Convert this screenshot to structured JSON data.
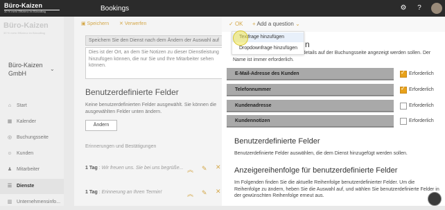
{
  "topbar": {
    "logo_title": "Büro-Kaizen",
    "logo_tagline": "30 % mehr Effizienz im Büroalltag",
    "app_title": "Bookings",
    "settings_icon": "gear-icon",
    "help_icon": "question-icon"
  },
  "sidebar": {
    "brand": "Büro-Kaizen",
    "brand_tag": "30 % mehr Effizienz im Büroalltag",
    "company": "Büro-Kaizen GmbH",
    "items": [
      {
        "label": "Start",
        "icon": "home-icon"
      },
      {
        "label": "Kalender",
        "icon": "calendar-icon"
      },
      {
        "label": "Buchungsseite",
        "icon": "globe-icon"
      },
      {
        "label": "Kunden",
        "icon": "people-icon"
      },
      {
        "label": "Mitarbeiter",
        "icon": "person-icon"
      },
      {
        "label": "Dienste",
        "icon": "list-icon",
        "active": true
      },
      {
        "label": "Unternehmensinfo...",
        "icon": "building-icon"
      }
    ]
  },
  "middle": {
    "save_label": "Speichern",
    "discard_label": "Verwerfen",
    "hint": "Speichern Sie den Dienst nach dem Ändern der Auswahl auf",
    "notes": "Dies ist der Ort, an dem Sie Notizen zu dieser Dienstleistung hinzufügen können, die nur Sie und Ihre Mitarbeiter sehen können.",
    "custom_fields_heading": "Benutzerdefinierte Felder",
    "custom_fields_text": "Keine benutzerdefinierten Felder ausgewählt. Sie können die ausgewählten Felder unten ändern.",
    "change_button": "Ändern",
    "reminders_heading": "Erinnerungen und Bestätigungen",
    "reminders": [
      {
        "when": "1 Tag",
        "text": "Wir freuen uns. Sie bei uns begrüße..."
      },
      {
        "when": "1 Tag",
        "text": "Erinnerung an Ihren Termin!"
      }
    ]
  },
  "panel": {
    "ok_label": "OK",
    "add_question_label": "Add a question",
    "dropdown_items": [
      "Textfrage hinzufügen",
      "Dropdownfrage hinzufügen"
    ],
    "heading_partial": "n",
    "intro": "Wählen Sie aus, welche Kundendetails auf der Buchungsseite angezeigt werden sollen. Der Name ist immer erforderlich.",
    "fields": [
      {
        "label": "E-Mail-Adresse des Kunden",
        "required": true
      },
      {
        "label": "Telefonnummer",
        "required": true
      },
      {
        "label": "Kundenadresse",
        "required": false
      },
      {
        "label": "Kundennotizen",
        "required": false
      }
    ],
    "required_label": "Erforderlich",
    "custom_heading": "Benutzerdefinierte Felder",
    "custom_text": "Benutzerdefinierte Felder auswählen, die dem Dienst hinzugefügt werden sollen.",
    "order_heading": "Anzeigereihenfolge für benutzerdefinierte Felder",
    "order_text": "Im Folgenden finden Sie die aktuelle Reihenfolge benutzerdefinierter Felder. Um die Reihenfolge zu ändern, heben Sie die Auswahl auf, und wählen Sie benutzerdefinierte Felder in der gewünschten Reihenfolge erneut aus."
  },
  "colors": {
    "accent": "#d4a84a",
    "topbar": "#2b2b2b",
    "field_row": "#a9a9a9",
    "checkbox_on": "#e8a21a"
  }
}
